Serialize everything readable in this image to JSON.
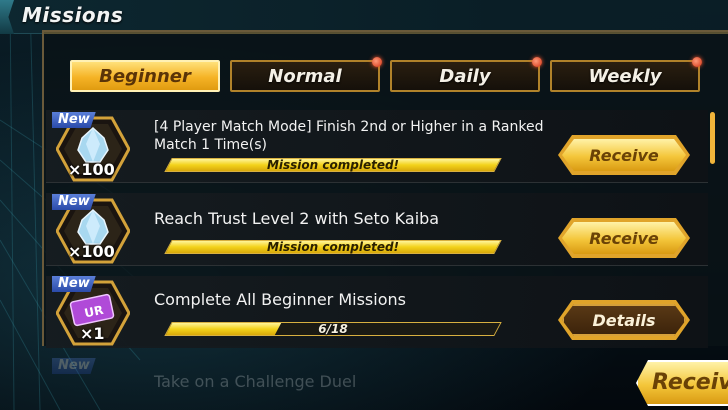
{
  "header": {
    "title": "Missions"
  },
  "tabs": [
    {
      "label": "Beginner",
      "active": true,
      "dot": false
    },
    {
      "label": "Normal",
      "active": false,
      "dot": true
    },
    {
      "label": "Daily",
      "active": false,
      "dot": true
    },
    {
      "label": "Weekly",
      "active": false,
      "dot": true
    }
  ],
  "missions": [
    {
      "badge": "New",
      "reward_icon": "gem-crystal-icon",
      "quantity": "×100",
      "text_line1": "[4 Player Match Mode] Finish 2nd or Higher in a Ranked",
      "text_line2": "Match 1 Time(s)",
      "progress_label": "Mission completed!",
      "progress_fraction": 1.0,
      "button": "Receive"
    },
    {
      "badge": "New",
      "reward_icon": "gem-crystal-icon",
      "quantity": "×100",
      "text_line1": "Reach Trust Level 2 with Seto Kaiba",
      "progress_label": "Mission completed!",
      "progress_fraction": 1.0,
      "button": "Receive"
    },
    {
      "badge": "New",
      "reward_icon": "ur-ticket-icon",
      "reward_icon_text": "UR",
      "quantity": "×1",
      "text_line1": "Complete All Beginner Missions",
      "progress_label": "6/18",
      "progress_fraction": 0.333,
      "button": "Details"
    }
  ],
  "ghost_row": {
    "badge": "New",
    "text": "Take on a Challenge Duel"
  },
  "corner_button": "Receive",
  "colors": {
    "accent_gold": "#f5b326",
    "progress_yellow": "#f3d21a",
    "new_badge_blue": "#2a4aa8",
    "notification_red": "#d23010"
  }
}
